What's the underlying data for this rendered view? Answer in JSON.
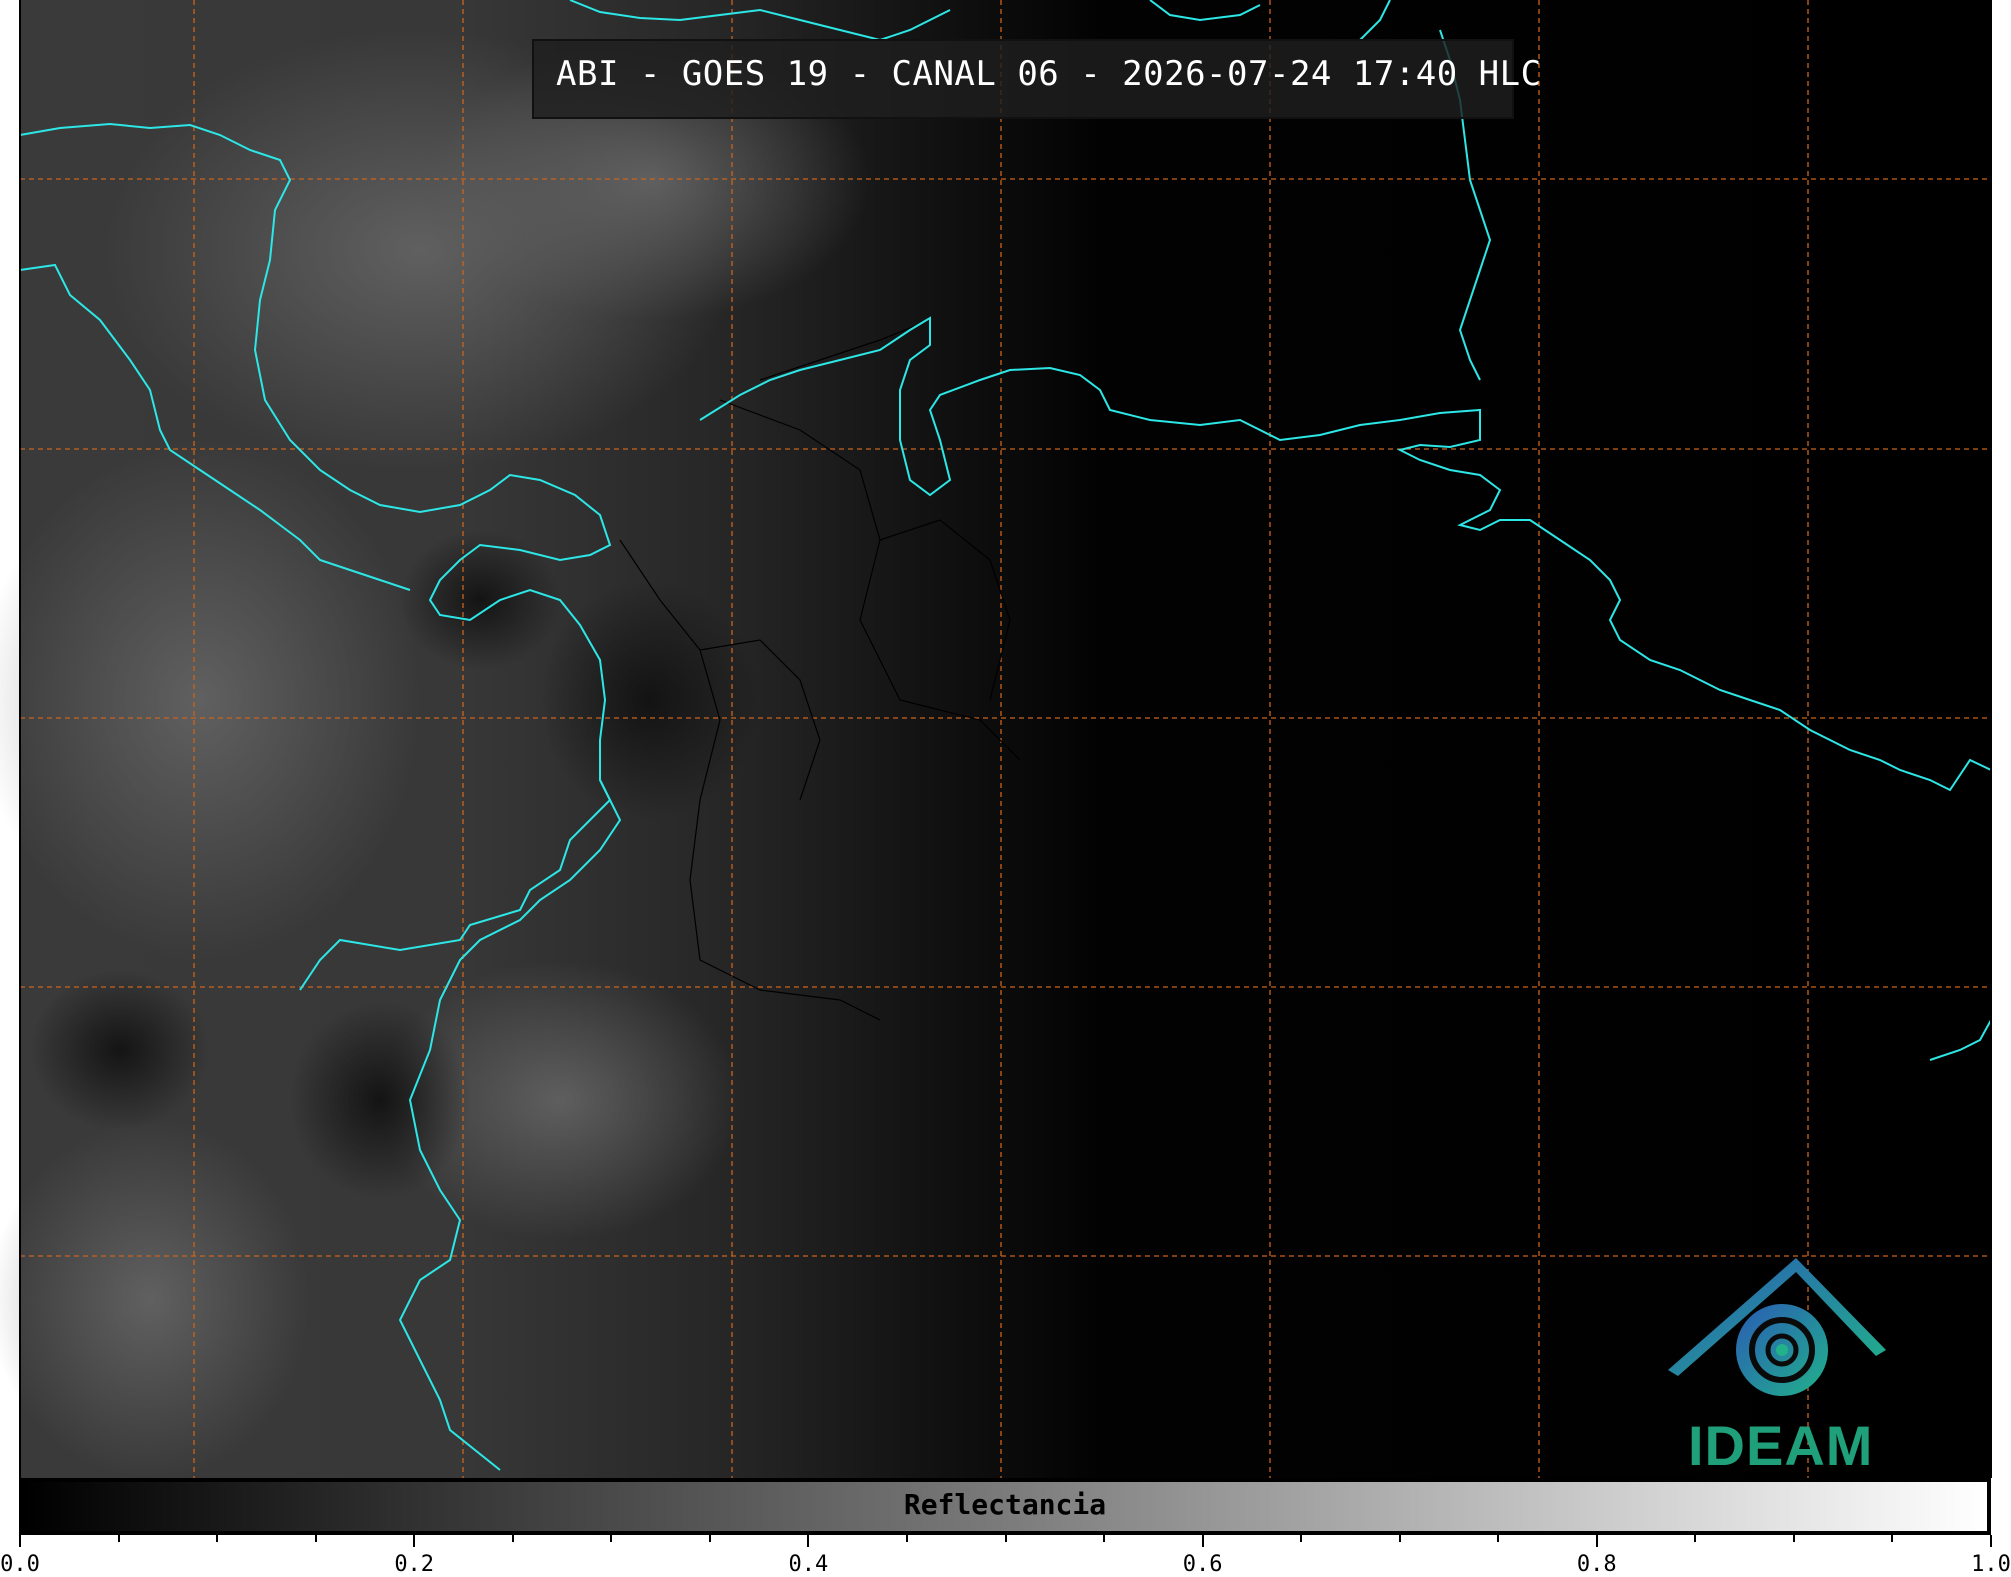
{
  "title": "ABI - GOES 19 - CANAL 06 - 2026-07-24 17:40 HLC",
  "colorbar": {
    "label": "Reflectancia",
    "ticks": [
      "0.0",
      "0.2",
      "0.4",
      "0.6",
      "0.8",
      "1.0"
    ],
    "range": [
      0.0,
      1.0
    ],
    "colormap": "grayscale"
  },
  "logo": {
    "text": "IDEAM",
    "color": "#1f9f7a"
  },
  "colors": {
    "coastline": "#2de6e6",
    "gridlines": "#c8651e",
    "borders": "#000000"
  }
}
